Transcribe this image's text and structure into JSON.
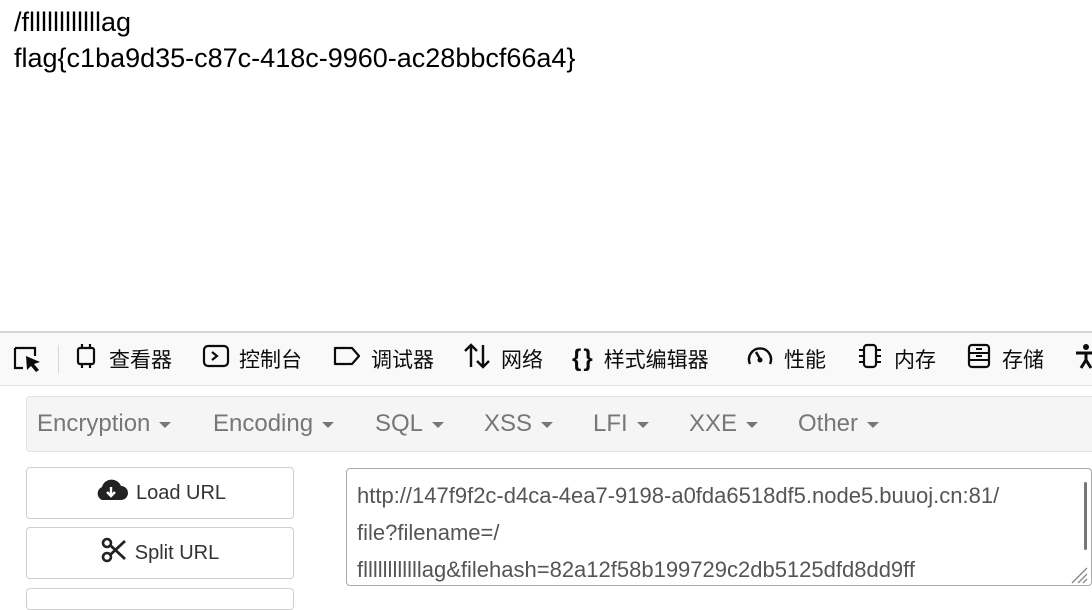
{
  "page": {
    "line1": "/fllllllllllllag",
    "line2": "flag{c1ba9d35-c87c-418c-9960-ac28bbcf66a4}"
  },
  "devtools": {
    "tabs": [
      {
        "label": "查看器",
        "icon": "inspector-icon"
      },
      {
        "label": "控制台",
        "icon": "console-icon"
      },
      {
        "label": "调试器",
        "icon": "debugger-icon"
      },
      {
        "label": "网络",
        "icon": "network-icon"
      },
      {
        "label": "样式编辑器",
        "icon": "style-editor-icon"
      },
      {
        "label": "性能",
        "icon": "performance-icon"
      },
      {
        "label": "内存",
        "icon": "memory-icon"
      },
      {
        "label": "存储",
        "icon": "storage-icon"
      }
    ]
  },
  "hackbar": {
    "menus": [
      "Encryption",
      "Encoding",
      "SQL",
      "XSS",
      "LFI",
      "XXE",
      "Other"
    ],
    "buttons": {
      "load": "Load URL",
      "split": "Split URL"
    },
    "url_lines": [
      "http://147f9f2c-d4ca-4ea7-9198-a0fda6518df5.node5.buuoj.cn:81/",
      "file?filename=/",
      "fllllllllllllag&filehash=82a12f58b199729c2db5125dfd8dd9ff"
    ]
  }
}
